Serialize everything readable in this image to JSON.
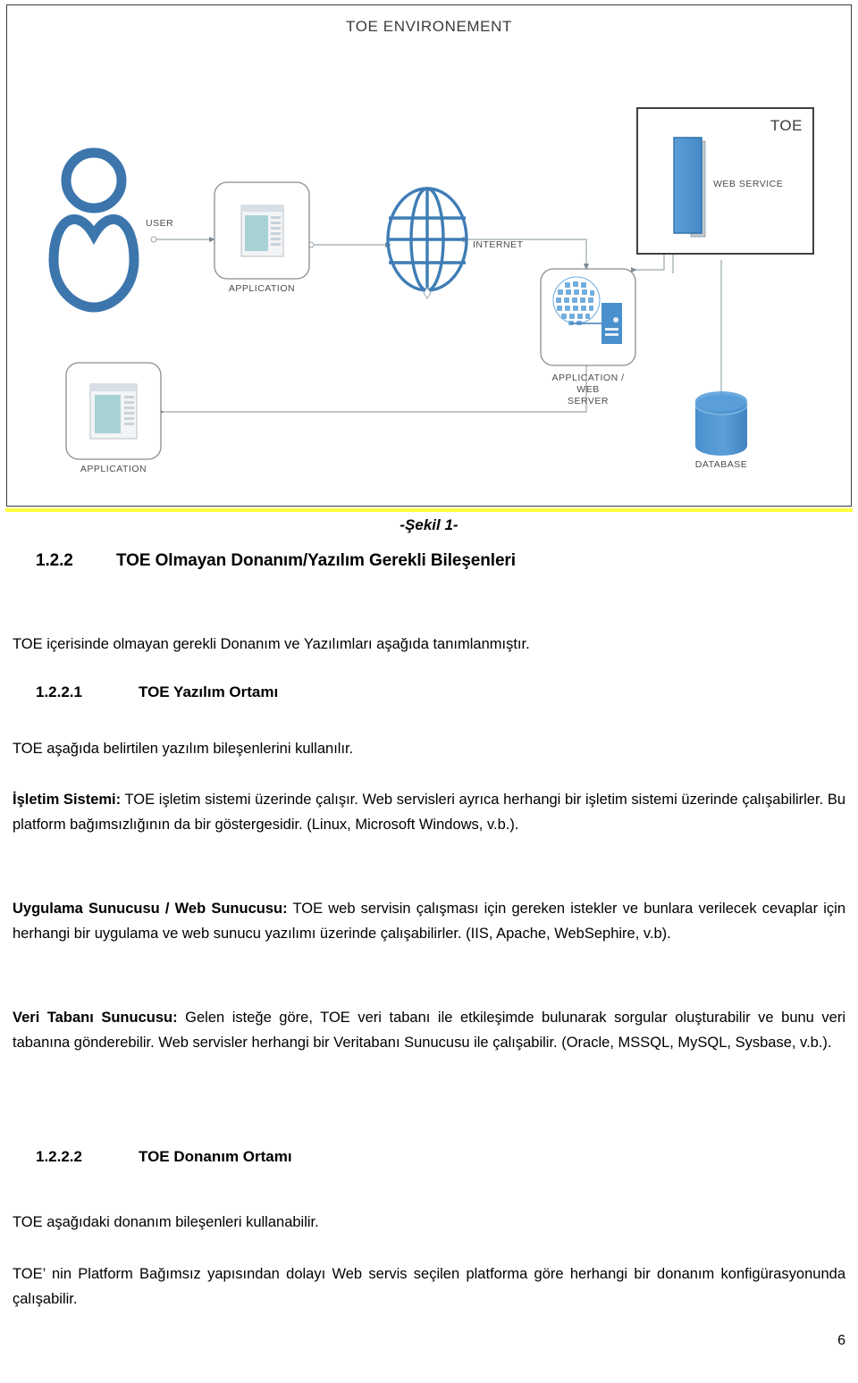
{
  "figure": {
    "environment_title": "TOE ENVIRONEMENT",
    "toe_box_label": "TOE",
    "caption": "-Şekil 1-",
    "nodes": {
      "user": "USER",
      "application_top": "APPLICATION",
      "application_bottom": "APPLICATION",
      "internet": "INTERNET",
      "web_service": "WEB SERVICE",
      "app_web_server": "APPLICATION / WEB\nSERVER",
      "database": "DATABASE"
    },
    "colors": {
      "node_blue": "#4a90cc",
      "user_blue": "#3c76ad",
      "connector_gray": "#8f9aa3",
      "frame_border": "#3a3a3a",
      "highlight_rule": "#ffff3f"
    }
  },
  "sections": {
    "s122": {
      "number": "1.2.2",
      "title": "TOE Olmayan Donanım/Yazılım Gerekli Bileşenleri"
    },
    "intro_paragraph": "TOE içerisinde olmayan gerekli Donanım ve Yazılımları aşağıda tanımlanmıştır.",
    "s1221": {
      "number": "1.2.2.1",
      "title": "TOE Yazılım Ortamı"
    },
    "s1221_intro": "TOE aşağıda belirtilen yazılım bileşenlerini kullanılır.",
    "items": [
      {
        "term": "İşletim Sistemi:",
        "body": " TOE işletim sistemi üzerinde çalışır. Web servisleri ayrıca herhangi bir işletim sistemi üzerinde çalışabilirler. Bu platform bağımsızlığının da bir göstergesidir. (Linux, Microsoft Windows, v.b.)."
      },
      {
        "term": "Uygulama Sunucusu / Web Sunucusu:",
        "body": " TOE web servisin çalışması için gereken istekler ve bunlara verilecek cevaplar için herhangi bir uygulama ve web sunucu yazılımı üzerinde çalışabilirler. (IIS, Apache, WebSephire, v.b)."
      },
      {
        "term": "Veri Tabanı Sunucusu:",
        "body": " Gelen isteğe göre, TOE veri tabanı ile etkileşimde bulunarak sorgular oluşturabilir ve bunu veri tabanına gönderebilir.  Web servisler herhangi bir Veritabanı Sunucusu ile çalışabilir. (Oracle, MSSQL, MySQL, Sysbase, v.b.)."
      }
    ],
    "s1222": {
      "number": "1.2.2.2",
      "title": "TOE Donanım Ortamı"
    },
    "s1222_p1": "TOE aşağıdaki donanım bileşenleri kullanabilir.",
    "s1222_p2": "TOE’ nin Platform Bağımsız yapısından dolayı Web servis seçilen platforma göre herhangi bir donanım konfigürasyonunda çalışabilir."
  },
  "page_number": "6"
}
